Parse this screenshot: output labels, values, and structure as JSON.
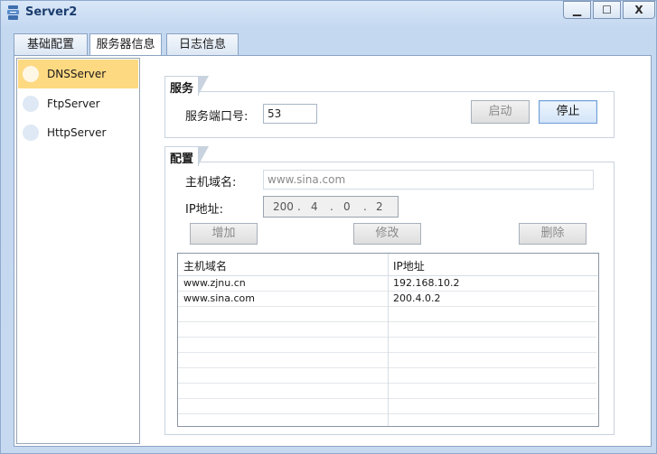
{
  "window": {
    "title": "Server2",
    "controls": {
      "minimize": "▁",
      "maximize": "☐",
      "close": "X"
    }
  },
  "tabs": [
    {
      "label": "基础配置",
      "active": false
    },
    {
      "label": "服务器信息",
      "active": true
    },
    {
      "label": "日志信息",
      "active": false
    }
  ],
  "sidebar": {
    "items": [
      {
        "label": "DNSServer",
        "selected": true
      },
      {
        "label": "FtpServer",
        "selected": false
      },
      {
        "label": "HttpServer",
        "selected": false
      }
    ]
  },
  "service": {
    "section_title": "服务",
    "port_label": "服务端口号:",
    "port_value": "53",
    "start_label": "启动",
    "stop_label": "停止"
  },
  "config": {
    "section_title": "配置",
    "host_label": "主机域名:",
    "host_value": "www.sina.com",
    "ip_label": "IP地址:",
    "ip_octets": [
      "200",
      "4",
      "0",
      "2"
    ],
    "ip_dots": [
      ".",
      ".",
      "."
    ],
    "add_label": "增加",
    "modify_label": "修改",
    "delete_label": "删除"
  },
  "table": {
    "headers": [
      "主机域名",
      "IP地址"
    ],
    "rows": [
      [
        "www.zjnu.cn",
        "192.168.10.2"
      ],
      [
        "www.sina.com",
        "200.4.0.2"
      ]
    ]
  }
}
